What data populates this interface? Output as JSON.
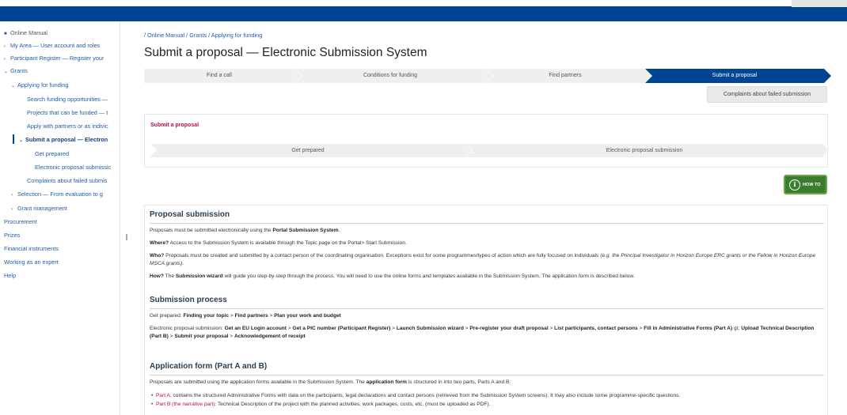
{
  "sidebar": {
    "items": [
      {
        "label": "Online Manual"
      },
      {
        "label": "My Area — User account and roles"
      },
      {
        "label": "Participant Register — Register your"
      },
      {
        "label": "Grants"
      },
      {
        "label": "Applying for funding"
      },
      {
        "label": "Search funding opportunities —"
      },
      {
        "label": "Projects that can be funded — t"
      },
      {
        "label": "Apply with partners or as indivic"
      },
      {
        "label": "Submit a proposal — Electron"
      },
      {
        "label": "Get prepared"
      },
      {
        "label": "Electronic proposal submissic"
      },
      {
        "label": "Complaints about failed submis"
      },
      {
        "label": "Selection — From evaluation to g"
      },
      {
        "label": "Grant management"
      },
      {
        "label": "Procurement"
      },
      {
        "label": "Prizes"
      },
      {
        "label": "Financial instruments"
      },
      {
        "label": "Working as an expert"
      },
      {
        "label": "Help"
      }
    ]
  },
  "breadcrumb": {
    "text": "/ Online Manual / Grants / Applying for funding"
  },
  "page_title": "Submit a proposal — Electronic Submission System",
  "steps": [
    {
      "label": "Find a call"
    },
    {
      "label": "Conditions for funding"
    },
    {
      "label": "Find partners"
    },
    {
      "label": "Submit a proposal"
    }
  ],
  "complaints_button": "Complaints about failed submission",
  "sub_panel": {
    "title": "Submit a proposal",
    "steps": [
      {
        "label": "Get prepared"
      },
      {
        "label": "Electronic proposal submission"
      }
    ]
  },
  "howto": {
    "icon_letter": "i",
    "label": "HOW TO"
  },
  "content": {
    "proposal_submission": {
      "heading": "Proposal submission",
      "p1_a": "Proposals must be submitted electronically using the ",
      "p1_b": "Portal Submission System",
      "p1_c": ".",
      "p2_a": "Where?",
      "p2_b": " Access to the Submission System is available through the Topic page on the Portal> Start Submission.",
      "p3_a": "Who?",
      "p3_b": " Proposals must be created and submitted by a contact person of the coordinating organisation. Exceptions exist for some programmes/types of action which are fully focused on individuals ",
      "p3_c": "(e.g. the Principal Investigator in Horizon Europe ERC grants or the Fellow in Horizon Europe MSCA grants)",
      "p3_d": ".",
      "p4_a": "How?",
      "p4_b": " The ",
      "p4_c": "Submission wizard",
      "p4_d": " will guide you step-by-step through the process. You will need to use the online forms and templates available in the Submission System. The application form is described below."
    },
    "submission_process": {
      "heading": "Submission process",
      "l1_a": "Get prepared: ",
      "l1_b": "Finding your topic",
      "l1_c": " > ",
      "l1_d": "Find partners",
      "l1_e": " > ",
      "l1_f": "Plan your work and budget",
      "l2_a": "Electronic proposal submission: ",
      "l2_b": "Get an EU Login account",
      "l2_c": " > ",
      "l2_d": "Get a PIC number (Participant Register)",
      "l2_e": " > ",
      "l2_f": "Launch Submission wizard",
      "l2_g": " > ",
      "l2_h": "Pre-register your draft proposal",
      "l2_i": " > ",
      "l2_j": "List participants, contact persons",
      "l2_k": " > ",
      "l2_l": "Fill in Administrative Forms (Part A)",
      "l2_m": " gt; ",
      "l2_n": "Upload Technical Description (Part B)",
      "l2_o": " > ",
      "l2_p": "Submit your proposal",
      "l2_q": " > ",
      "l2_r": "Acknowledgement of receipt"
    },
    "application_form": {
      "heading": "Application form (Part A and B)",
      "p_a": "Proposals are submitted using the application forms available in the Submission System. The ",
      "p_b": "application form",
      "p_c": " is structured in into two parts, Parts A and B:",
      "b1_a": "Part A:",
      "b1_b": " contains the structured Administrative Forms with data on the participants, legal declarations and contact persons (retrieved from the Submission System screens). It may also include some programme-specific questions.",
      "b2_a": "Part B (the narrative part):",
      "b2_b": " Technical Description of the project with the planned activities, work packages, costs, etc. (must be uploaded as PDF)."
    }
  },
  "colors": {
    "brand": "#004494",
    "accent_red": "#b3123b",
    "howto_green": "#3b7d2f",
    "link": "#1f5ca8"
  }
}
